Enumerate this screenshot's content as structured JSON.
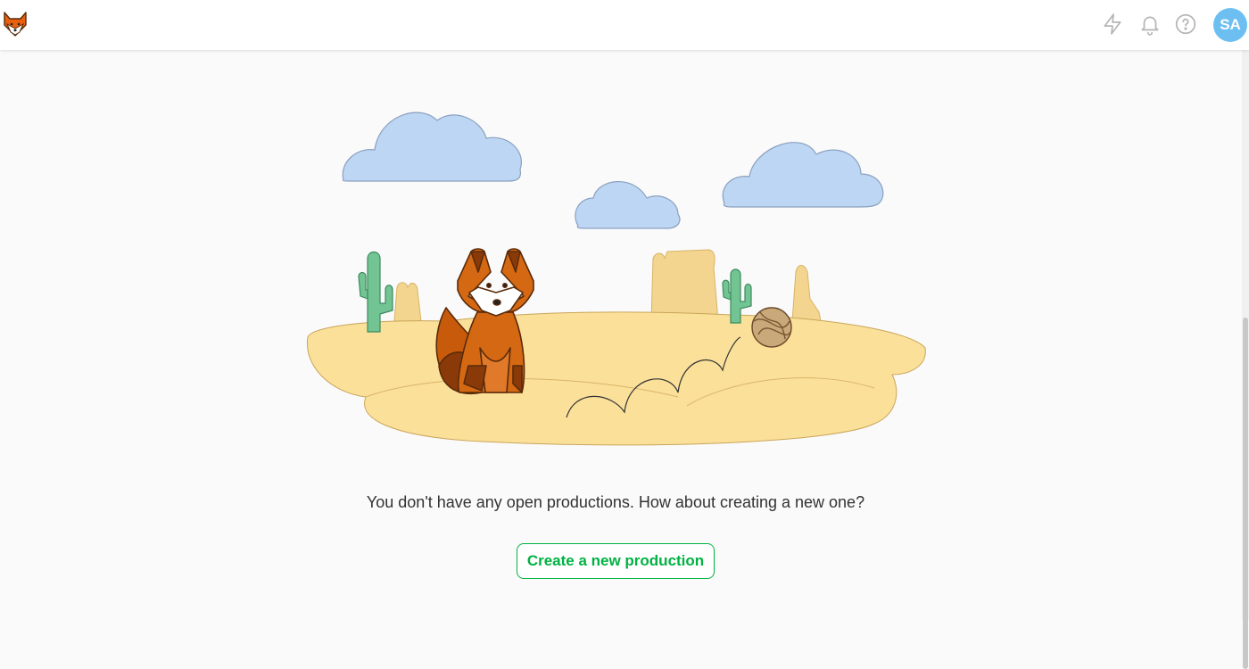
{
  "header": {
    "logo_icon": "fox-logo-icon",
    "actions": [
      {
        "icon": "lightning-icon"
      },
      {
        "icon": "bell-icon"
      },
      {
        "icon": "help-circle-icon"
      }
    ],
    "avatar_initials": "SA",
    "avatar_color": "#6dbff2"
  },
  "main": {
    "illustration_icon": "desert-fox-illustration",
    "empty_message": "You don't have any open productions. How about creating a new one?",
    "create_button_label": "Create a new production",
    "accent_color": "#00b242"
  }
}
